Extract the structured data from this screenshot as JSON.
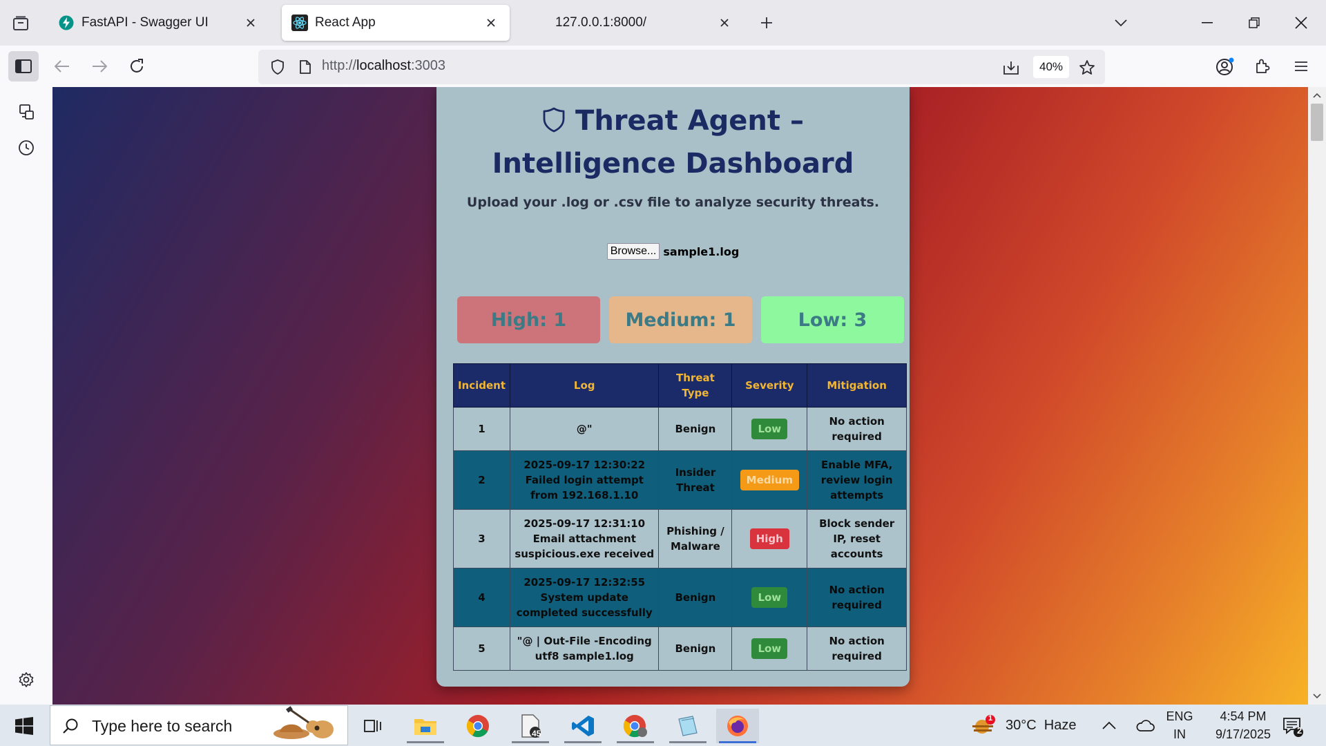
{
  "browser": {
    "tabs": [
      {
        "label": "FastAPI - Swagger UI",
        "favicon": "fastapi-icon",
        "active": false
      },
      {
        "label": "React App",
        "favicon": "react-icon",
        "active": true
      },
      {
        "label": "127.0.0.1:8000/",
        "favicon": "none",
        "active": false
      }
    ],
    "url_prefix": "http://",
    "url_host": "localhost",
    "url_suffix": ":3003",
    "zoom": "40%"
  },
  "page": {
    "title": "Threat Agent – Intelligence Dashboard",
    "subtitle": "Upload your .log or .csv file to analyze security threats.",
    "browse_label": "Browse...",
    "file_name": "sample1.log",
    "summary": {
      "high": "High: 1",
      "medium": "Medium: 1",
      "low": "Low: 3"
    },
    "colors": {
      "high": "#cc7479",
      "medium": "#e5b78a",
      "low": "#8ef89e",
      "header_bg": "#1b2b6a",
      "header_text": "#f2b632"
    },
    "table": {
      "headers": [
        "Incident",
        "Log",
        "Threat Type",
        "Severity",
        "Mitigation"
      ],
      "rows": [
        {
          "incident": "1",
          "log": "@\"",
          "threat_type": "Benign",
          "severity": "Low",
          "mitigation": "No action required"
        },
        {
          "incident": "2",
          "log": "2025-09-17 12:30:22 Failed login attempt from 192.168.1.10",
          "threat_type": "Insider Threat",
          "severity": "Medium",
          "mitigation": "Enable MFA, review login attempts"
        },
        {
          "incident": "3",
          "log": "2025-09-17 12:31:10 Email attachment suspicious.exe received",
          "threat_type": "Phishing / Malware",
          "severity": "High",
          "mitigation": "Block sender IP, reset accounts"
        },
        {
          "incident": "4",
          "log": "2025-09-17 12:32:55 System update completed successfully",
          "threat_type": "Benign",
          "severity": "Low",
          "mitigation": "No action required"
        },
        {
          "incident": "5",
          "log": "\"@ | Out-File -Encoding utf8 sample1.log",
          "threat_type": "Benign",
          "severity": "Low",
          "mitigation": "No action required"
        }
      ]
    }
  },
  "taskbar": {
    "search_placeholder": "Type here to search",
    "file_badge": "45",
    "weather": "30°C  Haze",
    "weather_badge": "1",
    "lang_1": "ENG",
    "lang_2": "IN",
    "time": "4:54 PM",
    "date": "9/17/2025",
    "notifications": "2"
  }
}
